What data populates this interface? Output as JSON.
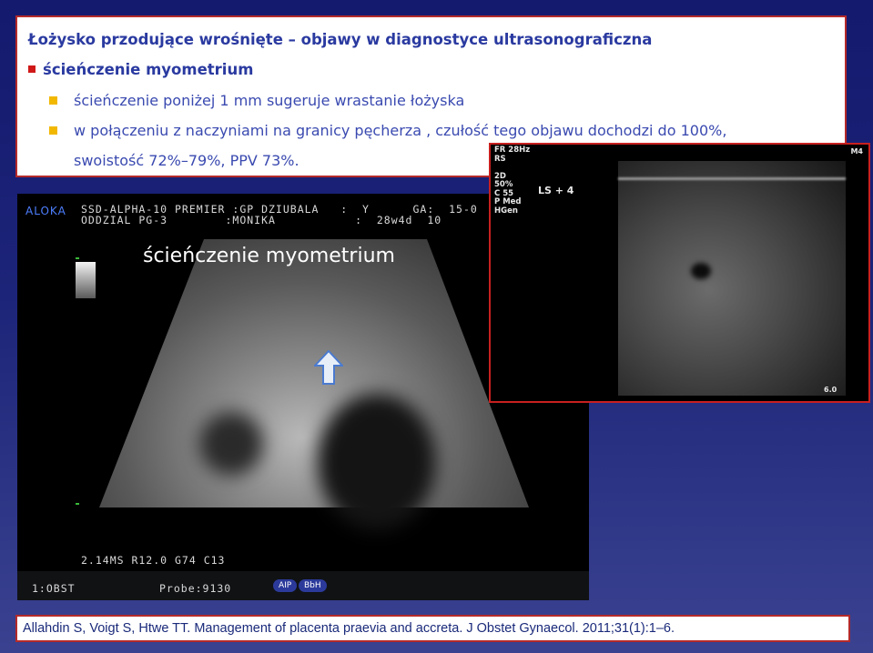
{
  "header_box": {
    "title": "Łożysko przodujące wrośnięte – objawy w diagnostyce ultrasonograficzna",
    "bullet_main": "ścieńczenie myometrium",
    "sub_bullets": [
      "ścieńczenie poniżej 1 mm sugeruje wrastanie łożyska",
      "w połączeniu z naczyniami na granicy pęcherza , czułość  tego objawu dochodzi do 100%,",
      "swoistość  72%–79%, PPV 73%."
    ]
  },
  "ultrasound_main": {
    "logo": "ALOKA",
    "header_line1": "SSD-ALPHA-10 PREMIER :GP DZIUBALA   :  Y      GA:  15-0",
    "header_line2": "ODDZIAL PG-3        :MONIKA           :  28w4d  10",
    "overlay_label": "ścieńczenie myometrium",
    "bottom_line": "2.14MS R12.0 G74 C13",
    "footer_left": "1:OBST",
    "footer_probe": "Probe:9130",
    "pills": [
      "AIP",
      "BbH"
    ]
  },
  "ultrasound_inset": {
    "side_params": [
      "FR 28Hz",
      "RS",
      "",
      "2D",
      "50%",
      "C 55",
      "P Med",
      "HGen"
    ],
    "view_label": "LS  +  4",
    "corner_label": "M4",
    "depth_label": "6.0"
  },
  "reference": "Allahdin S, Voigt S, Htwe TT. Management of placenta praevia and accreta. J Obstet Gynaecol. 2011;31(1):1–6."
}
